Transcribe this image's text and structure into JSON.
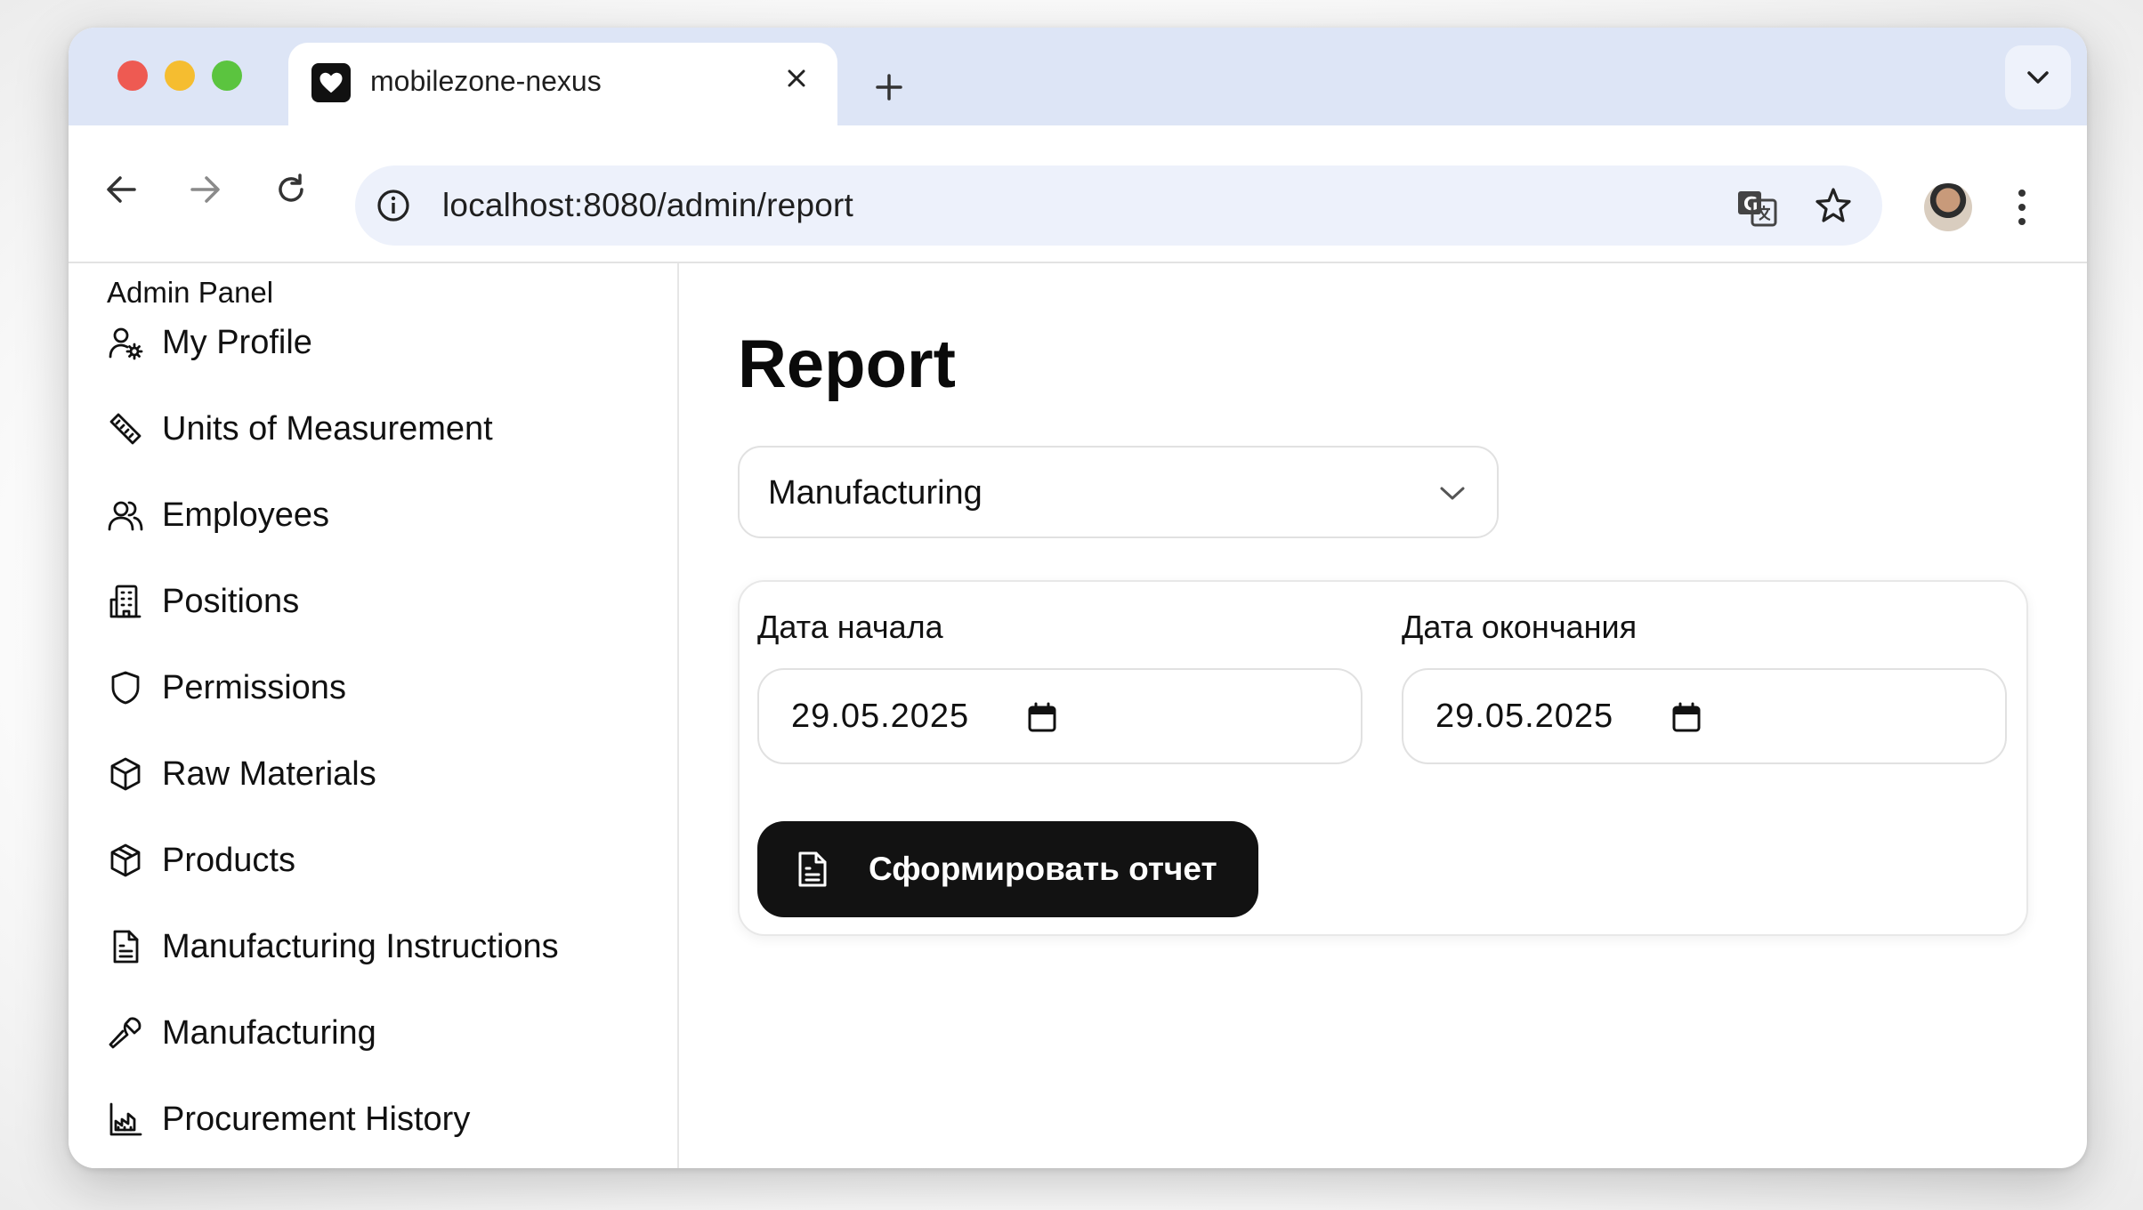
{
  "browser": {
    "tab_title": "mobilezone-nexus",
    "url": "localhost:8080/admin/report"
  },
  "sidebar": {
    "title": "Admin Panel",
    "items": [
      {
        "label": "My Profile",
        "icon": "user-gear-icon"
      },
      {
        "label": "Units of Measurement",
        "icon": "ruler-icon"
      },
      {
        "label": "Employees",
        "icon": "users-icon"
      },
      {
        "label": "Positions",
        "icon": "building-icon"
      },
      {
        "label": "Permissions",
        "icon": "shield-icon"
      },
      {
        "label": "Raw Materials",
        "icon": "box-icon"
      },
      {
        "label": "Products",
        "icon": "package-icon"
      },
      {
        "label": "Manufacturing Instructions",
        "icon": "document-icon"
      },
      {
        "label": "Manufacturing",
        "icon": "wrench-icon"
      },
      {
        "label": "Procurement History",
        "icon": "factory-icon"
      }
    ]
  },
  "main": {
    "title": "Report",
    "report_type": {
      "selected": "Manufacturing"
    },
    "start_date": {
      "label": "Дата начала",
      "value": "29.05.2025"
    },
    "end_date": {
      "label": "Дата окончания",
      "value": "29.05.2025"
    },
    "submit_label": "Сформировать отчет"
  },
  "colors": {
    "tabstrip": "#dde5f6",
    "button_bg": "#121212",
    "traffic_red": "#ee5a52",
    "traffic_yellow": "#f5bd30",
    "traffic_green": "#5bc43f"
  }
}
